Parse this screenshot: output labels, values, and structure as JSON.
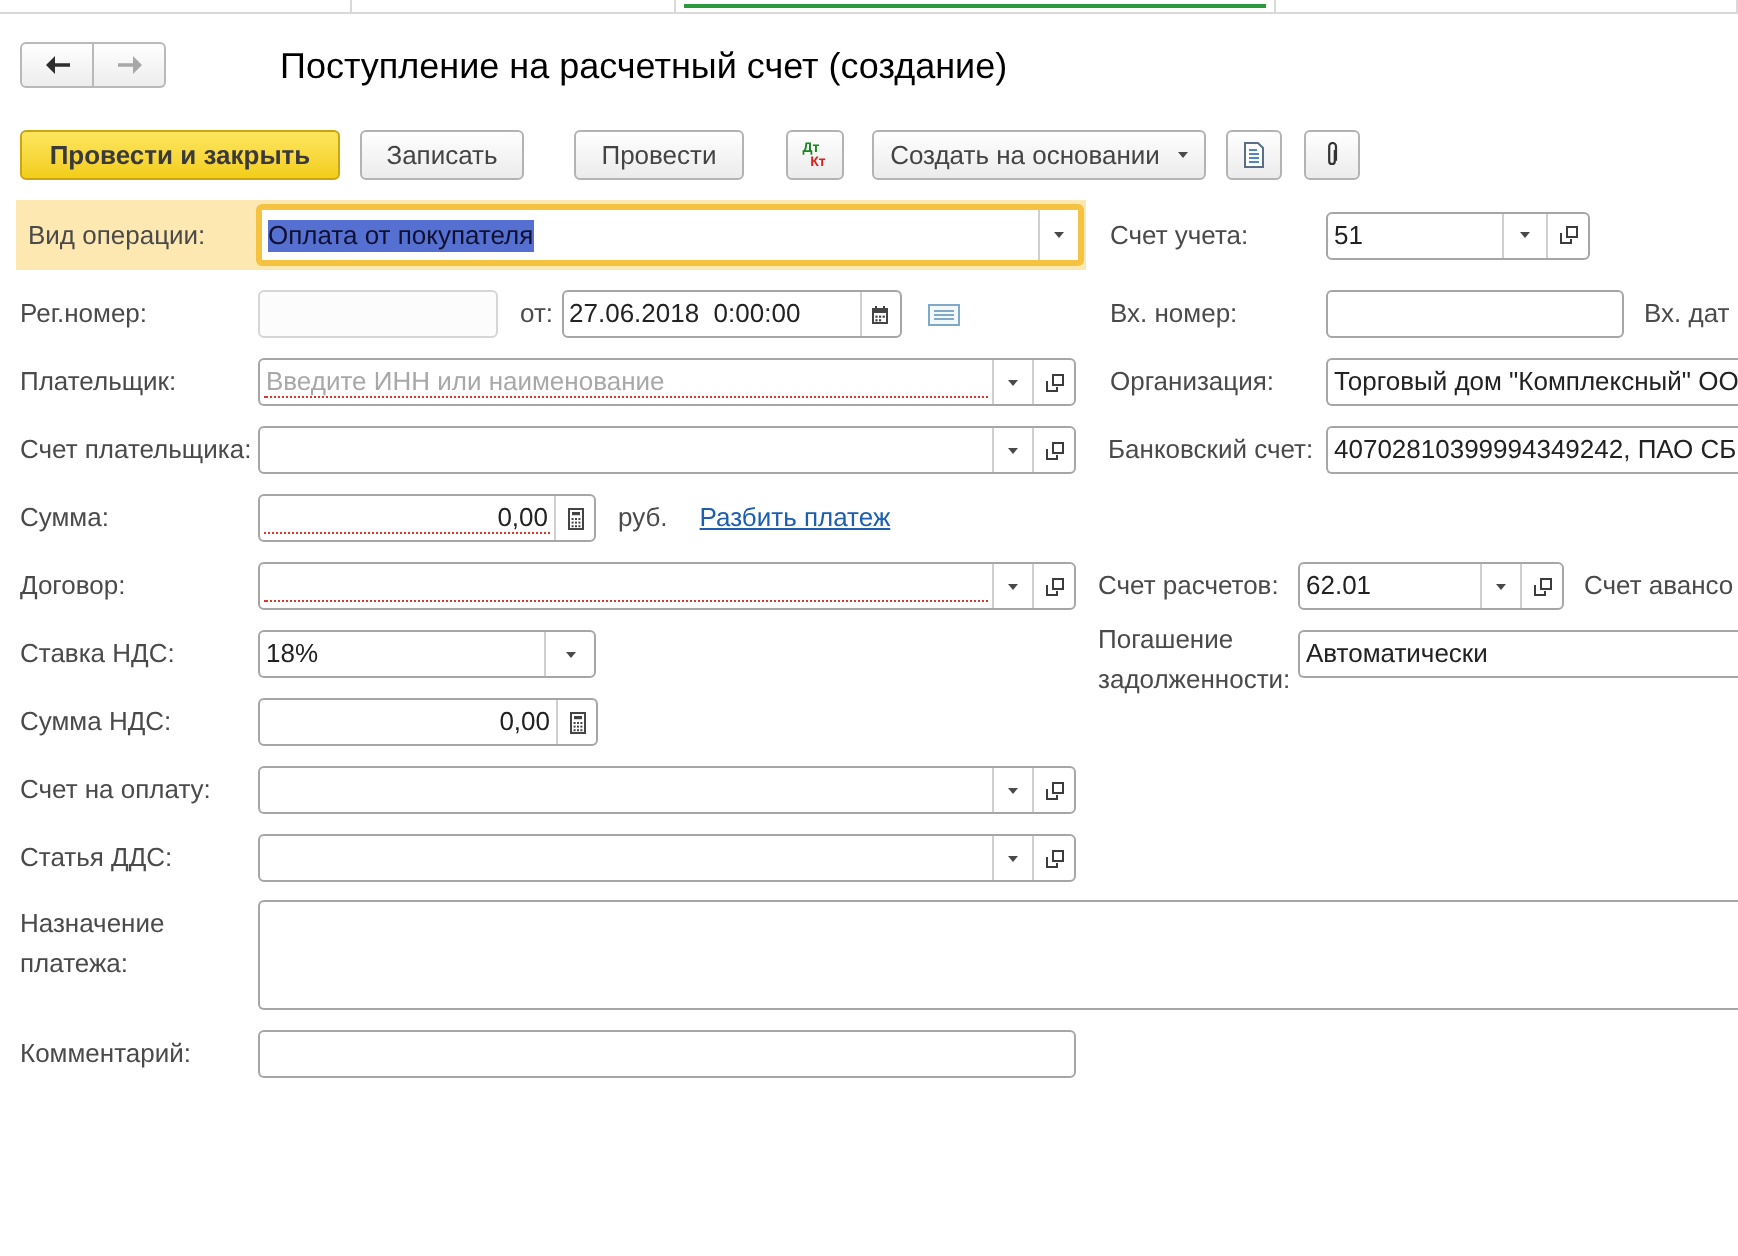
{
  "tabs": [
    {
      "selected": false
    },
    {
      "selected": false
    },
    {
      "selected": true
    },
    {
      "selected": false
    }
  ],
  "navigation": {
    "back": {
      "disabled": false
    },
    "forward": {
      "disabled": true
    }
  },
  "title": "Поступление на расчетный счет (создание)",
  "toolbar": [
    {
      "kind": "primary",
      "label": "Провести и закрыть"
    },
    {
      "kind": "button",
      "label": "Записать"
    },
    {
      "kind": "button",
      "label": "Провести"
    },
    {
      "kind": "dt_kt",
      "debit": "Дт",
      "credit": "Кт"
    },
    {
      "kind": "menu",
      "label": "Создать на основании"
    },
    {
      "kind": "report"
    },
    {
      "kind": "attachment"
    }
  ],
  "form": {
    "operation_type": {
      "label": "Вид операции:",
      "value": "Оплата от покупателя",
      "focused": true
    },
    "account": {
      "label": "Счет учета:",
      "value": "51"
    },
    "reg_number": {
      "label": "Рег.номер:",
      "disabled": true
    },
    "date": {
      "label": "от:",
      "value": "27.06.2018  0:00:00"
    },
    "incoming_number": {
      "label": "Вх. номер:"
    },
    "incoming_date": {
      "label": "Вх. дат"
    },
    "payer": {
      "label": "Плательщик:",
      "placeholder": "Введите ИНН или наименование",
      "required": true
    },
    "organization": {
      "label": "Организация:",
      "value": "Торговый дом \"Комплексный\" ОО"
    },
    "payer_account": {
      "label": "Счет плательщика:",
      "required": false
    },
    "bank_account": {
      "label": "Банковский счет:",
      "value": "40702810399994349242, ПАО СБ"
    },
    "amount": {
      "label": "Сумма:",
      "value": "0,00",
      "required": true,
      "currency": "руб.",
      "split_link": "Разбить платеж"
    },
    "contract": {
      "label": "Договор:",
      "required": true
    },
    "settlement_account": {
      "label": "Счет расчетов:",
      "value": "62.01"
    },
    "advance_account": {
      "label": "Счет авансо"
    },
    "vat_rate": {
      "label": "Ставка НДС:",
      "value": "18%"
    },
    "debt_repayment": {
      "label": "Погашение задолженности:",
      "value": "Автоматически"
    },
    "vat_amount": {
      "label": "Сумма НДС:",
      "value": "0,00"
    },
    "invoice": {
      "label": "Счет на оплату:",
      "required": false
    },
    "cash_flow_item": {
      "label": "Статья ДДС:",
      "required": false
    },
    "purpose": {
      "label": "Назначение платежа:"
    },
    "comment": {
      "label": "Комментарий:"
    }
  }
}
